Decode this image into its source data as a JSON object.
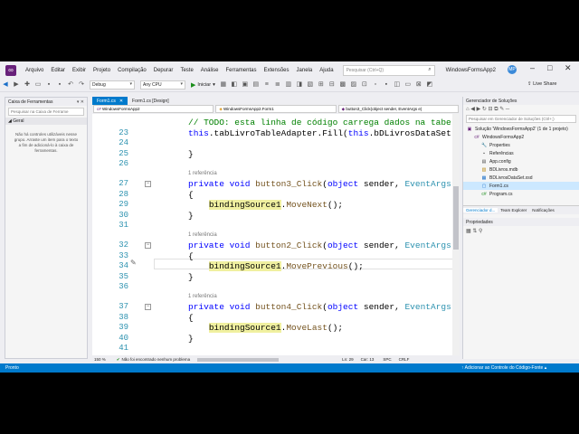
{
  "menubar": {
    "items": [
      "Arquivo",
      "Editar",
      "Exibir",
      "Projeto",
      "Compilação",
      "Depurar",
      "Teste",
      "Análise",
      "Ferramentas",
      "Extensões",
      "Janela",
      "Ajuda"
    ],
    "search_placeholder": "Pesquisar (Ctrl+Q)",
    "solution_name": "WindowsFormsApp2",
    "avatar_initials": "MP"
  },
  "toolbar": {
    "config": "Debug",
    "platform": "Any CPU",
    "start_label": "Iniciar",
    "liveshare_label": "Live Share"
  },
  "toolbox": {
    "title": "Caixa de Ferramentas",
    "search_placeholder": "Pesquisar na Caixa de Ferrame",
    "group": "Geral",
    "note": "Não há controles utilizáveis nesse grupo. Arraste um item para o texto a fim de adicioná-lo à caixa de ferramentas."
  },
  "editor": {
    "tabs": [
      {
        "label": "Form1.cs",
        "active": true
      },
      {
        "label": "Form1.cs [Design]",
        "active": false
      }
    ],
    "nav": {
      "project": "WindowsFormsApp2",
      "class": "WindowsFormsApp2.Form1",
      "member": "button3_Click(object sender, EventArgs e)"
    },
    "lines": [
      {
        "num": "",
        "parts": [
          {
            "t": "// TODO: esta linha de código carrega dados na tabela 'bDLivrosDataSet.",
            "c": "cm"
          }
        ]
      },
      {
        "num": "23",
        "parts": [
          {
            "t": "this",
            "c": "kw"
          },
          {
            "t": ".tabLivroTableAdapter.Fill(",
            "c": ""
          },
          {
            "t": "this",
            "c": "kw"
          },
          {
            "t": ".bDLivrosDataSet.TabLivro",
            "c": ""
          }
        ]
      },
      {
        "num": "24",
        "parts": []
      },
      {
        "num": "25",
        "parts": [
          {
            "t": "}",
            "c": ""
          }
        ]
      },
      {
        "num": "26",
        "parts": []
      },
      {
        "num": "27",
        "ref": "1 referência",
        "parts": [
          {
            "t": "private ",
            "c": "kw"
          },
          {
            "t": "void ",
            "c": "kw"
          },
          {
            "t": "button3_Click",
            "c": "mt"
          },
          {
            "t": "(",
            "c": ""
          },
          {
            "t": "object ",
            "c": "kw"
          },
          {
            "t": "sender, ",
            "c": ""
          },
          {
            "t": "EventArgs ",
            "c": "ty"
          },
          {
            "t": "e)",
            "c": ""
          }
        ]
      },
      {
        "num": "28",
        "parts": [
          {
            "t": "{",
            "c": ""
          }
        ]
      },
      {
        "num": "29",
        "parts": [
          {
            "t": "    ",
            "c": ""
          },
          {
            "t": "bindingSource1",
            "c": "hl"
          },
          {
            "t": ".",
            "c": ""
          },
          {
            "t": "MoveNext",
            "c": "mt"
          },
          {
            "t": "();",
            "c": ""
          }
        ]
      },
      {
        "num": "30",
        "parts": [
          {
            "t": "}",
            "c": ""
          }
        ]
      },
      {
        "num": "31",
        "parts": []
      },
      {
        "num": "32",
        "ref": "1 referência",
        "parts": [
          {
            "t": "private ",
            "c": "kw"
          },
          {
            "t": "void ",
            "c": "kw"
          },
          {
            "t": "button2_Click",
            "c": "mt"
          },
          {
            "t": "(",
            "c": ""
          },
          {
            "t": "object ",
            "c": "kw"
          },
          {
            "t": "sender, ",
            "c": ""
          },
          {
            "t": "EventArgs ",
            "c": "ty"
          },
          {
            "t": "e)",
            "c": ""
          }
        ]
      },
      {
        "num": "33",
        "parts": [
          {
            "t": "{",
            "c": ""
          }
        ]
      },
      {
        "num": "34",
        "parts": [
          {
            "t": "    ",
            "c": ""
          },
          {
            "t": "bindingSource1",
            "c": "hl"
          },
          {
            "t": ".",
            "c": ""
          },
          {
            "t": "MovePrevious",
            "c": "mt"
          },
          {
            "t": "();",
            "c": ""
          }
        ]
      },
      {
        "num": "35",
        "parts": [
          {
            "t": "}",
            "c": ""
          }
        ]
      },
      {
        "num": "36",
        "parts": []
      },
      {
        "num": "37",
        "ref": "1 referência",
        "parts": [
          {
            "t": "private ",
            "c": "kw"
          },
          {
            "t": "void ",
            "c": "kw"
          },
          {
            "t": "button4_Click",
            "c": "mt"
          },
          {
            "t": "(",
            "c": ""
          },
          {
            "t": "object ",
            "c": "kw"
          },
          {
            "t": "sender, ",
            "c": ""
          },
          {
            "t": "EventArgs ",
            "c": "ty"
          },
          {
            "t": "e)",
            "c": ""
          }
        ]
      },
      {
        "num": "38",
        "parts": [
          {
            "t": "{",
            "c": ""
          }
        ]
      },
      {
        "num": "39",
        "parts": [
          {
            "t": "    ",
            "c": ""
          },
          {
            "t": "bindingSource1",
            "c": "hl"
          },
          {
            "t": ".",
            "c": ""
          },
          {
            "t": "MoveLast",
            "c": "mt"
          },
          {
            "t": "();",
            "c": ""
          }
        ]
      },
      {
        "num": "40",
        "parts": [
          {
            "t": "}",
            "c": ""
          }
        ]
      },
      {
        "num": "41",
        "parts": []
      }
    ],
    "status": {
      "zoom": "150 %",
      "problems": "Não foi encontrado nenhum problema",
      "line": "Ln: 29",
      "col": "Car: 13",
      "spc": "SPC",
      "crlf": "CRLF"
    }
  },
  "solution_explorer": {
    "title": "Gerenciador de Soluções",
    "search_placeholder": "Pesquisar em Gerenciador de Soluções (Ctrl+;)",
    "items": [
      {
        "label": "Solução 'WindowsFormsApp2' (1 de 1 projeto)",
        "indent": 0,
        "icon": "solution-icon"
      },
      {
        "label": "WindowsFormsApp2",
        "indent": 1,
        "icon": "csharp-project-icon"
      },
      {
        "label": "Properties",
        "indent": 2,
        "icon": "wrench-icon"
      },
      {
        "label": "Referências",
        "indent": 2,
        "icon": "references-icon"
      },
      {
        "label": "App.config",
        "indent": 2,
        "icon": "config-file-icon"
      },
      {
        "label": "BDLivros.mdb",
        "indent": 2,
        "icon": "database-icon"
      },
      {
        "label": "BDLivrosDataSet.xsd",
        "indent": 2,
        "icon": "dataset-icon"
      },
      {
        "label": "Form1.cs",
        "indent": 2,
        "icon": "form-icon",
        "selected": true
      },
      {
        "label": "Program.cs",
        "indent": 2,
        "icon": "csharp-file-icon"
      }
    ],
    "tabs": [
      "Gerenciador d...",
      "Team Explorer",
      "Notificações"
    ]
  },
  "properties": {
    "title": "Propriedades"
  },
  "statusbar": {
    "left": "Pronto",
    "right": "↑ Adicionar ao Controle do Código-Fonte ▴"
  },
  "colors": {
    "accent": "#007acc",
    "vs_purple": "#68217a",
    "keyword": "#0000ff",
    "comment": "#008000",
    "type": "#2b91af"
  }
}
